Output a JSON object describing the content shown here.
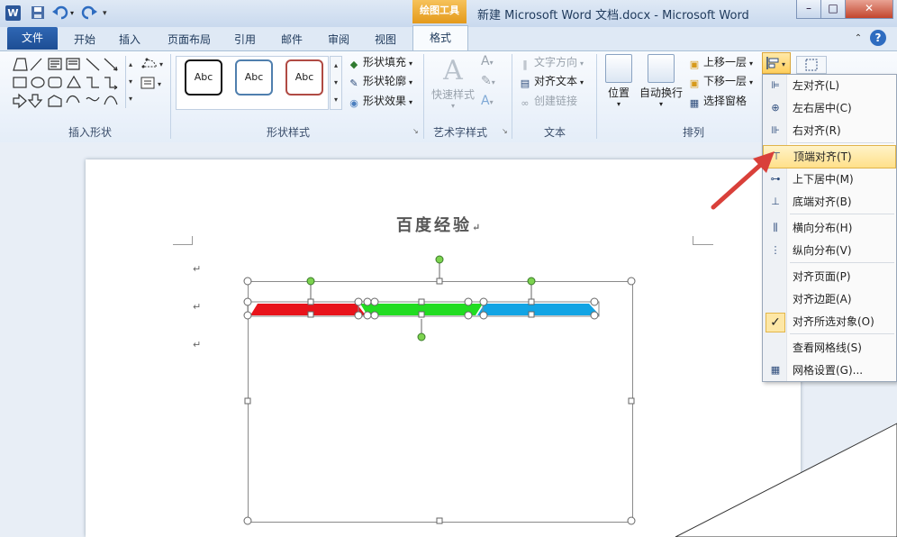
{
  "title_bar": {
    "app_logo": "W",
    "tool_header": "绘图工具",
    "window_title": "新建 Microsoft Word 文档.docx - Microsoft Word",
    "minimize": "–",
    "restore": "□",
    "close": "✕"
  },
  "tabs": [
    {
      "label": "文件"
    },
    {
      "label": "开始"
    },
    {
      "label": "插入"
    },
    {
      "label": "页面布局"
    },
    {
      "label": "引用"
    },
    {
      "label": "邮件"
    },
    {
      "label": "审阅"
    },
    {
      "label": "视图"
    },
    {
      "label": "格式"
    }
  ],
  "ribbon": {
    "insert_shapes": {
      "label": "插入形状"
    },
    "shape_styles": {
      "label": "形状样式",
      "style_samples": [
        "Abc",
        "Abc",
        "Abc"
      ],
      "fill": "形状填充",
      "outline": "形状轮廓",
      "effects": "形状效果"
    },
    "wordart": {
      "label": "艺术字样式",
      "quick_styles": "快速样式"
    },
    "text": {
      "label": "文本",
      "direction": "文字方向",
      "align_text": "对齐文本",
      "create_link": "创建链接"
    },
    "arrange": {
      "label": "排列",
      "position": "位置",
      "wrap": "自动换行",
      "bring_forward": "上移一层",
      "send_backward": "下移一层",
      "selection_pane": "选择窗格"
    }
  },
  "document": {
    "title": "百度经验",
    "para_mark": "↵"
  },
  "align_menu": {
    "items": [
      {
        "label": "左对齐(L)"
      },
      {
        "label": "左右居中(C)"
      },
      {
        "label": "右对齐(R)"
      },
      {
        "label": "顶端对齐(T)"
      },
      {
        "label": "上下居中(M)"
      },
      {
        "label": "底端对齐(B)"
      },
      {
        "label": "横向分布(H)"
      },
      {
        "label": "纵向分布(V)"
      },
      {
        "label": "对齐页面(P)"
      },
      {
        "label": "对齐边距(A)"
      },
      {
        "label": "对齐所选对象(O)"
      },
      {
        "label": "查看网格线(S)"
      },
      {
        "label": "网格设置(G)..."
      }
    ],
    "check_mark": "✓"
  },
  "colors": {
    "shape_red": "#e8131b",
    "shape_green": "#22dc22",
    "shape_blue": "#12a4e4",
    "menu_highlight": "#ffe08a",
    "arrow": "#d9403a"
  }
}
